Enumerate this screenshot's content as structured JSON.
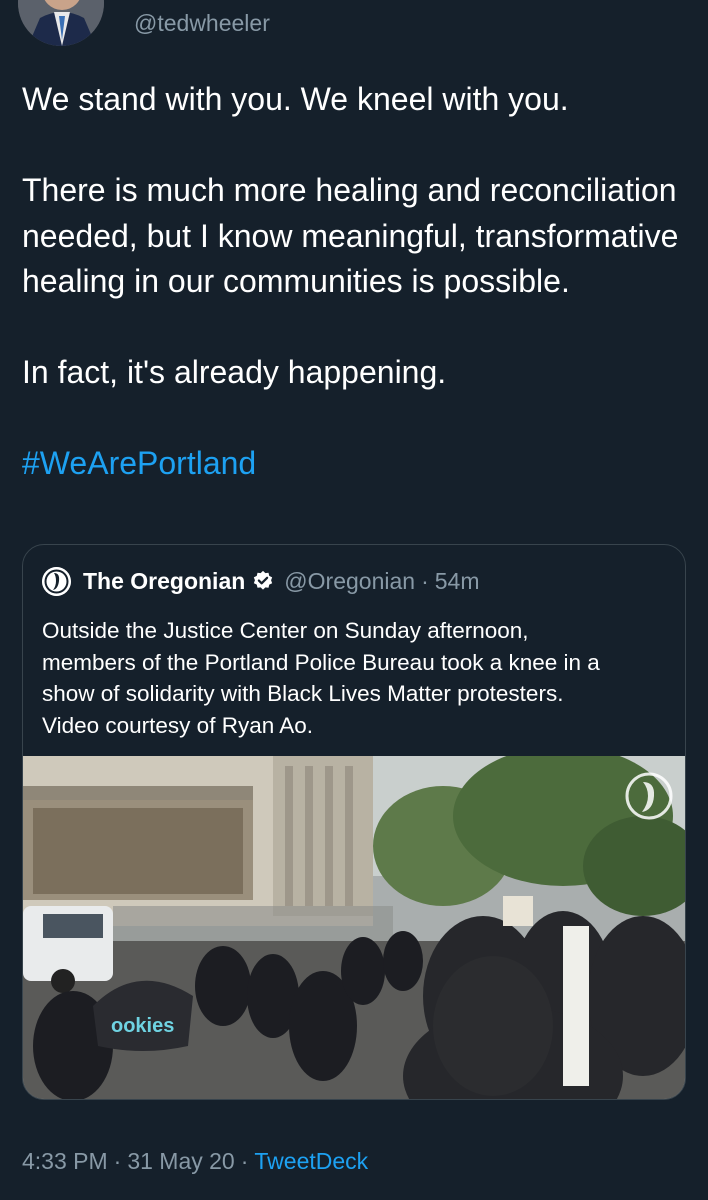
{
  "tweet": {
    "handle": "@tedwheeler",
    "avatar": "avatar-photo",
    "paragraphs": [
      "We stand with you. We kneel with you.",
      "There is much more healing and reconciliation needed, but I know meaningful, transformative healing in our communities is possible.",
      "In fact, it's already happening."
    ],
    "hashtag": "#WeArePortland",
    "hashtag_color": "#1da1f2"
  },
  "quoted_tweet": {
    "name": "The Oregonian",
    "verified": true,
    "handle": "@Oregonian",
    "separator": "·",
    "time": "54m",
    "text_lines": [
      "Outside the Justice Center on Sunday afternoon,",
      "members of the Portland Police Bureau took a knee in a",
      "show of solidarity with Black Lives Matter protesters.",
      "Video courtesy of Ryan Ao."
    ],
    "media": {
      "kind": "video-thumbnail",
      "hat_text": "ookies"
    }
  },
  "footer": {
    "time": "4:33 PM",
    "separator": "·",
    "date": "31 May 20",
    "source": "TweetDeck"
  },
  "colors": {
    "background": "#15202b",
    "text": "#ffffff",
    "secondary": "#8899a6",
    "accent": "#1da1f2",
    "border": "#38444d"
  }
}
